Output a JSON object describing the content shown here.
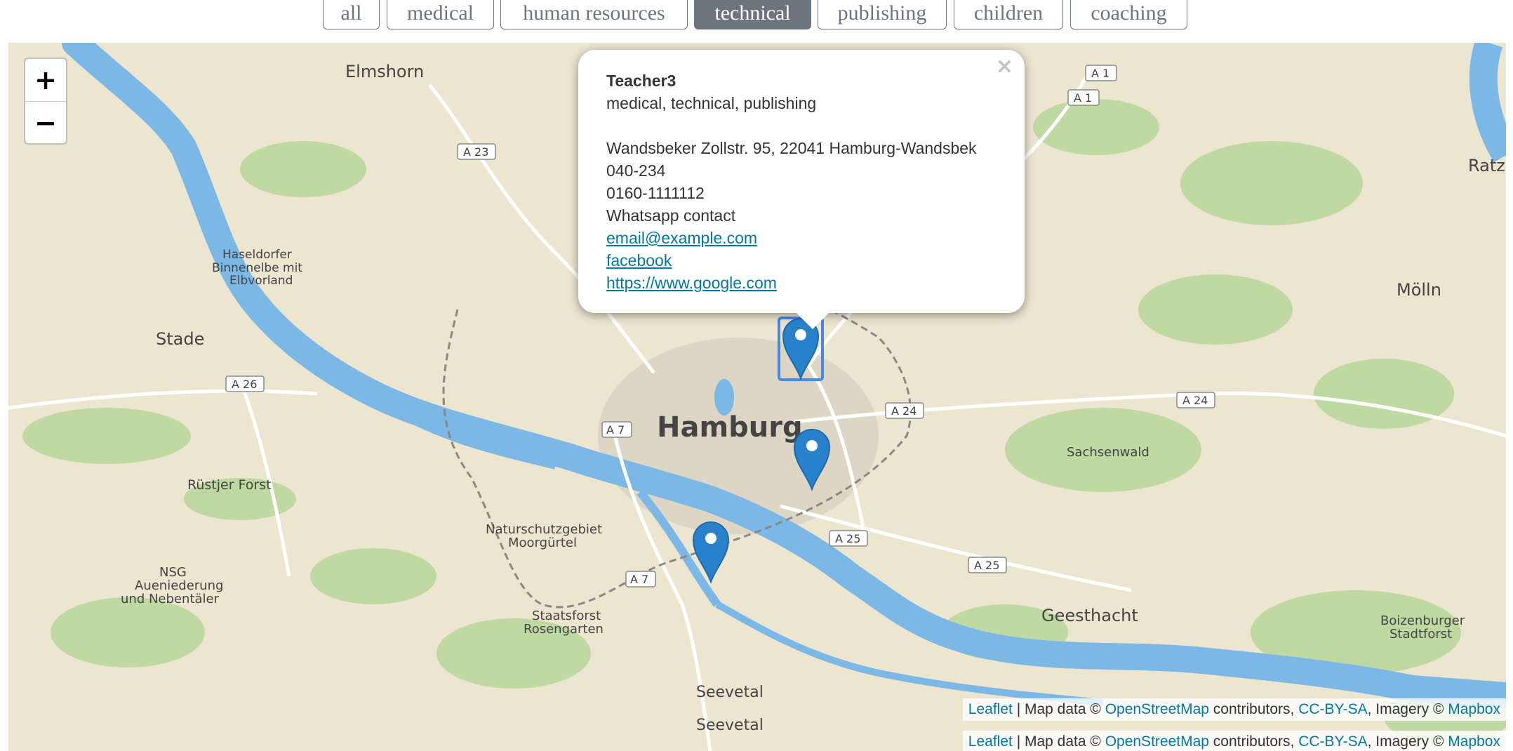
{
  "filters": [
    {
      "label": "all",
      "active": false
    },
    {
      "label": "medical",
      "active": false
    },
    {
      "label": "human resources",
      "active": false
    },
    {
      "label": "technical",
      "active": true
    },
    {
      "label": "publishing",
      "active": false
    },
    {
      "label": "children",
      "active": false
    },
    {
      "label": "coaching",
      "active": false
    }
  ],
  "zoom": {
    "in": "+",
    "out": "−"
  },
  "popup": {
    "name": "Teacher3",
    "categories": "medical, technical, publishing",
    "address": "Wandsbeker Zollstr. 95, 22041 Hamburg-Wandsbek",
    "phone": "040-234",
    "mobile": "0160-1111112",
    "whatsapp": "Whatsapp contact",
    "email": "email@example.com",
    "facebook": "facebook ",
    "website": "https://www.google.com",
    "close": "×"
  },
  "attribution": {
    "leaflet": "Leaflet",
    "sep": " | Map data © ",
    "osm": "OpenStreetMap",
    "contrib": " contributors, ",
    "license": "CC-BY-SA",
    "imagery": ", Imagery © ",
    "mapbox": "Mapbox"
  },
  "places": {
    "elmshorn": "Elmshorn",
    "haseldorfer": "Haseldorfer",
    "binnenelbe": "Binnenelbe mit",
    "elbvorland": "Elbvorland",
    "stade": "Stade",
    "hamburg": "Hamburg",
    "ruestjer": "Rüstjer Forst",
    "nsg": "NSG",
    "auenied": "Aueniederung",
    "nebentaeler": "und Nebentäler",
    "naturschutz": "Naturschutzgebiet",
    "moorguertel": "Moorgürtel",
    "staatsforst": "Staatsforst",
    "rosengarten": "Rosengarten",
    "seevetal": "Seevetal",
    "sachsenwald": "Sachsenwald",
    "geesthacht": "Geesthacht",
    "moelln": "Mölln",
    "ratze": "Ratze",
    "boizenburger": "Boizenburger",
    "stadtforst": "Stadtforst"
  },
  "roads": {
    "a1": "A 1",
    "a23": "A 23",
    "a26": "A 26",
    "a7": "A 7",
    "a24": "A 24",
    "a25": "A 25"
  },
  "colors": {
    "land": "#ece5d0",
    "water": "#7cb8e6",
    "forest": "#b8d69a",
    "marker": "#2a81cb",
    "active_button": "#6c757d",
    "link": "#0078a8"
  },
  "markers": [
    {
      "name": "marker-wandsbek",
      "selected": true
    },
    {
      "name": "marker-hamburg-east",
      "selected": false
    },
    {
      "name": "marker-harburg",
      "selected": false
    }
  ]
}
